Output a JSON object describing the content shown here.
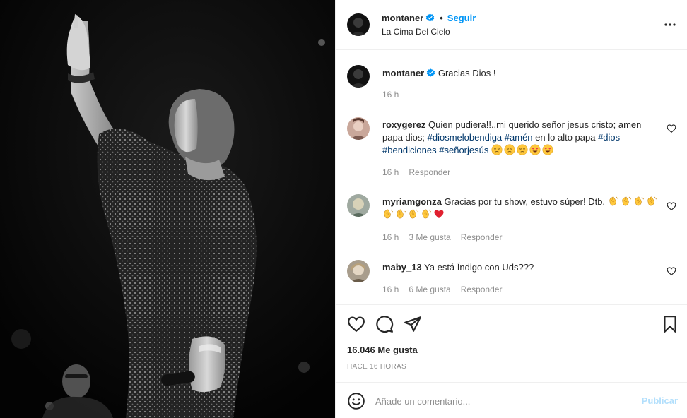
{
  "post": {
    "author": "montaner",
    "location": "La Cima Del Cielo",
    "follow_label": "Seguir",
    "separator": "•",
    "caption": "Gracias Dios !",
    "caption_time": "16 h",
    "likes": "16.046 Me gusta",
    "time_ago": "HACE 16 HORAS"
  },
  "comments": [
    {
      "user": "roxygerez",
      "text_1": "Quien pudiera!!..mi querido señor jesus cristo; amen papa dios;",
      "tags_1": [
        "#diosmelobendiga",
        "#amén"
      ],
      "text_2": "en lo alto papa",
      "tags_2": [
        "#dios",
        "#bendiciones",
        "#señorjesús"
      ],
      "time": "16 h",
      "reply": "Responder"
    },
    {
      "user": "myriamgonza",
      "text": "Gracias por tu show, estuvo súper! Dtb.",
      "time": "16 h",
      "likes": "3 Me gusta",
      "reply": "Responder"
    },
    {
      "user": "maby_13",
      "text": "Ya está Índigo con Uds???",
      "time": "16 h",
      "likes": "6 Me gusta",
      "reply": "Responder"
    }
  ],
  "add_comment": {
    "placeholder": "Añade un comentario...",
    "publish_label": "Publicar"
  },
  "colors": {
    "accent": "#0095f6",
    "hashtag": "#00376b",
    "muted": "#8e8e8e",
    "publish_disabled": "#b2dffc",
    "heart_red": "#ed4956"
  },
  "icons": {
    "verified": "verified-badge-icon",
    "more": "more-options-icon",
    "like": "heart-icon",
    "comment": "comment-icon",
    "share": "share-icon",
    "save": "bookmark-icon",
    "emoji": "smiley-icon"
  }
}
